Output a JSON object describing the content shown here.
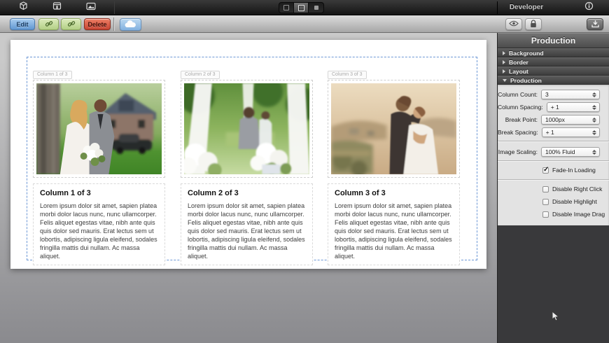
{
  "menubar": {
    "panel_title": "Developer"
  },
  "toolbar": {
    "edit_label": "Edit",
    "delete_label": "Delete"
  },
  "panel": {
    "title": "Production",
    "sections": [
      {
        "label": "Background",
        "expanded": false
      },
      {
        "label": "Border",
        "expanded": false
      },
      {
        "label": "Layout",
        "expanded": false
      },
      {
        "label": "Production",
        "expanded": true
      }
    ],
    "fields": [
      {
        "label": "Column Count:",
        "value": "3"
      },
      {
        "label": "Column Spacing:",
        "value": "+ 1"
      },
      {
        "label": "Break Point:",
        "value": "1000px"
      },
      {
        "label": "Break Spacing:",
        "value": "+ 1"
      },
      {
        "label": "Image Scaling:",
        "value": "100% Fluid"
      }
    ],
    "checkboxes": [
      {
        "label": "Fade-In Loading",
        "checked": true
      },
      {
        "label": "Disable Right Click",
        "checked": false
      },
      {
        "label": "Disable Highlight",
        "checked": false
      },
      {
        "label": "Disable Image Drag",
        "checked": false
      }
    ]
  },
  "canvas": {
    "columns": [
      {
        "tag": "Column 1 of 3",
        "heading": "Column 1 of 3",
        "image_alt": "bride-and-groom-by-tree-with-house-and-car",
        "body": "Lorem ipsum dolor sit amet, sapien platea morbi dolor lacus nunc, nunc ullamcorper. Felis aliquet egestas vitae, nibh ante quis quis dolor sed mauris. Erat lectus sem ut lobortis, adipiscing ligula eleifend, sodales fringilla mattis dui nullam. Ac massa aliquet."
      },
      {
        "tag": "Column 2 of 3",
        "heading": "Column 2 of 3",
        "image_alt": "wedding-ceremony-white-drapes-and-bouquets",
        "body": "Lorem ipsum dolor sit amet, sapien platea morbi dolor lacus nunc, nunc ullamcorper. Felis aliquet egestas vitae, nibh ante quis quis dolor sed mauris. Erat lectus sem ut lobortis, adipiscing ligula eleifend, sodales fringilla mattis dui nullam. Ac massa aliquet."
      },
      {
        "tag": "Column 3 of 3",
        "heading": "Column 3 of 3",
        "image_alt": "couple-embracing-warm-sunset-hills",
        "body": "Lorem ipsum dolor sit amet, sapien platea morbi dolor lacus nunc, nunc ullamcorper. Felis aliquet egestas vitae, nibh ante quis quis dolor sed mauris. Erat lectus sem ut lobortis, adipiscing ligula eleifend, sodales fringilla mattis dui nullam. Ac massa aliquet."
      }
    ]
  }
}
